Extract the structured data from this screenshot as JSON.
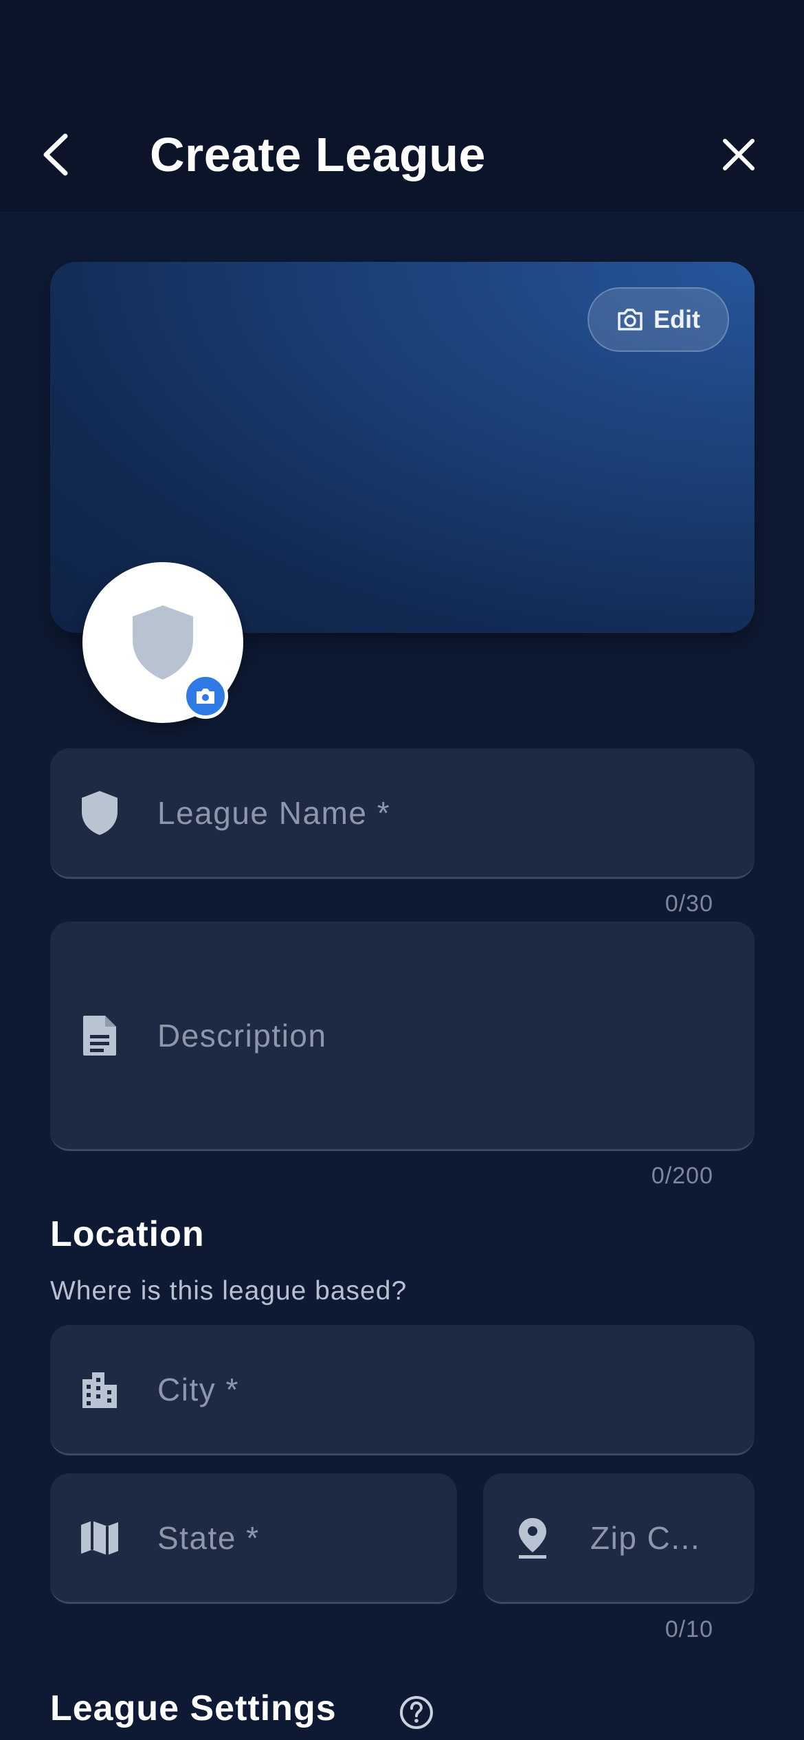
{
  "header": {
    "title": "Create League",
    "back_icon": "chevron-left-icon",
    "close_icon": "close-icon"
  },
  "banner": {
    "edit_label": "Edit",
    "edit_icon": "camera-icon"
  },
  "avatar": {
    "icon": "shield-icon",
    "camera_icon": "camera-icon"
  },
  "fields": {
    "league_name": {
      "placeholder": "League Name *",
      "value": "",
      "counter": "0/30",
      "icon": "shield-icon"
    },
    "description": {
      "placeholder": "Description",
      "value": "",
      "counter": "0/200",
      "icon": "document-icon"
    },
    "city": {
      "placeholder": "City *",
      "value": "",
      "icon": "building-icon"
    },
    "state": {
      "placeholder": "State *",
      "value": "",
      "icon": "map-icon"
    },
    "zip": {
      "placeholder": "Zip C...",
      "value": "",
      "counter": "0/10",
      "icon": "location-pin-icon"
    }
  },
  "location": {
    "title": "Location",
    "subtitle": "Where is this league based?"
  },
  "settings": {
    "title": "League Settings",
    "help_icon": "help-circle-icon"
  },
  "colors": {
    "background": "#0e1a33",
    "header": "#0b1429",
    "field": "#1e2a44",
    "accent": "#2f7ae5",
    "placeholder": "#8c97aa",
    "icon": "#b8c4d2"
  }
}
